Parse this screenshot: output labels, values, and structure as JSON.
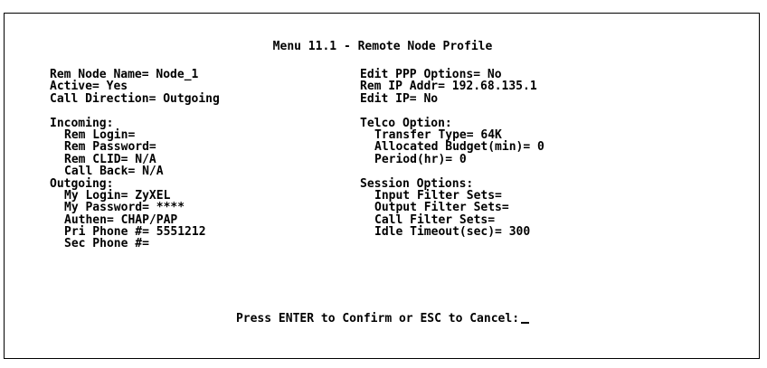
{
  "menu_title": "Menu 11.1 - Remote Node Profile",
  "left": {
    "rem_node_name": "Rem Node Name= Node_1",
    "active": "Active= Yes",
    "call_direction": "Call Direction= Outgoing",
    "incoming_header": "Incoming:",
    "rem_login": "Rem Login=",
    "rem_password": "Rem Password=",
    "rem_clid": "Rem CLID= N/A",
    "call_back": "Call Back= N/A",
    "outgoing_header": "Outgoing:",
    "my_login": "My Login= ZyXEL",
    "my_password": "My Password= ****",
    "authen": "Authen= CHAP/PAP",
    "pri_phone": "Pri Phone #= 5551212",
    "sec_phone": "Sec Phone #="
  },
  "right": {
    "edit_ppp": "Edit PPP Options= No",
    "rem_ip": "Rem IP Addr= 192.68.135.1",
    "edit_ip": "Edit IP= No",
    "telco_header": "Telco Option:",
    "transfer_type": "Transfer Type= 64K",
    "allocated_budget": "Allocated Budget(min)= 0",
    "period": "Period(hr)= 0",
    "session_header": "Session Options:",
    "input_filter": "Input Filter Sets=",
    "output_filter": "Output Filter Sets=",
    "call_filter": "Call Filter Sets=",
    "idle_timeout": "Idle Timeout(sec)= 300"
  },
  "prompt": "Press ENTER to Confirm or ESC to Cancel:"
}
